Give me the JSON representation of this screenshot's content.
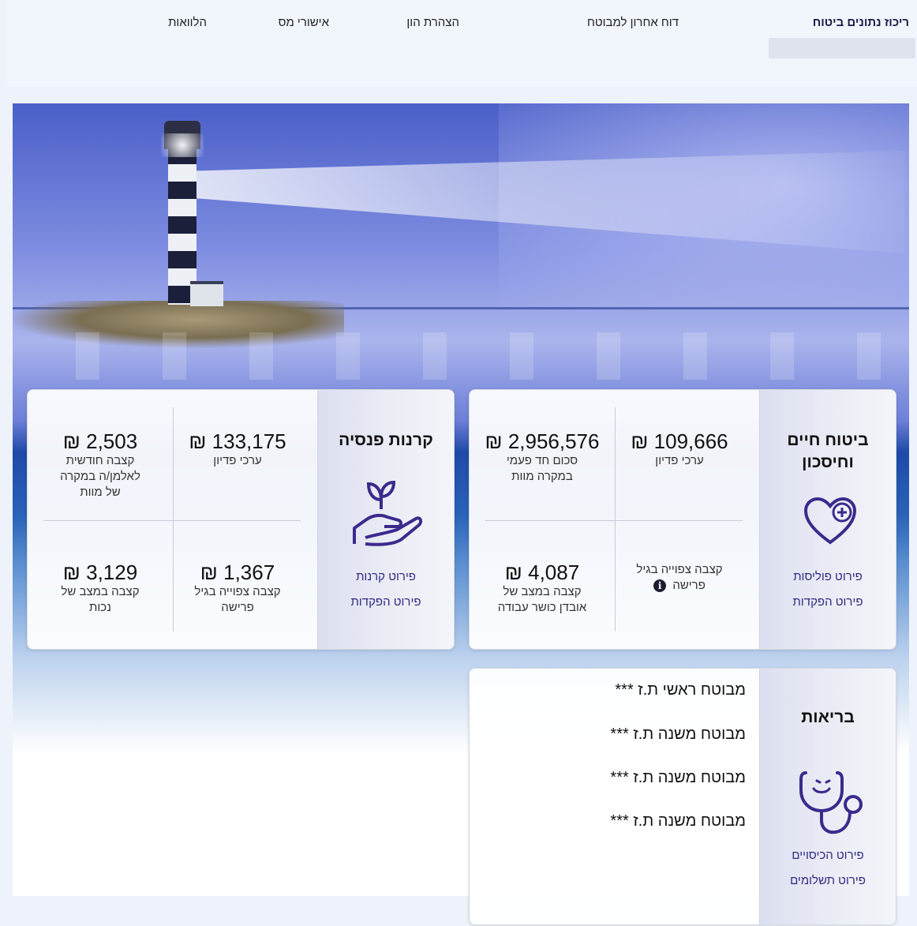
{
  "nav": {
    "tabs": [
      {
        "label": "ריכוז נתונים ביטוח"
      },
      {
        "label": "דוח אחרון למבוטח"
      },
      {
        "label": "הצהרת הון"
      },
      {
        "label": "אישורי מס"
      },
      {
        "label": "הלוואות"
      }
    ]
  },
  "life": {
    "title_line1": "ביטוח חיים",
    "title_line2": "וחיסכון",
    "icon": "heart-plus-icon",
    "links": [
      "פירוט פוליסות",
      "פירוט הפקדות"
    ],
    "cells": [
      {
        "amount": "109,666 ₪",
        "label_lines": [
          "ערכי פדיון"
        ]
      },
      {
        "amount": "2,956,576 ₪",
        "label_lines": [
          "סכום חד פעמי",
          "במקרה מוות"
        ]
      },
      {
        "amount": "",
        "label_lines": [
          "קצבה צפוייה בגיל",
          "פרישה"
        ]
      },
      {
        "amount": "4,087 ₪",
        "label_lines": [
          "קצבה במצב של",
          "אובדן כושר עבודה"
        ]
      }
    ]
  },
  "pension": {
    "title": "קרנות פנסיה",
    "icon": "hand-plant-icon",
    "links": [
      "פירוט קרנות",
      "פירוט הפקדות"
    ],
    "cells": [
      {
        "amount": "133,175 ₪",
        "label_lines": [
          "ערכי פדיון"
        ]
      },
      {
        "amount": "2,503 ₪",
        "label_lines": [
          "קצבה חודשית",
          "לאלמן/ה במקרה",
          "של מוות"
        ]
      },
      {
        "amount": "1,367 ₪",
        "label_lines": [
          "קצבה צפוייה בגיל",
          "פרישה"
        ]
      },
      {
        "amount": "3,129 ₪",
        "label_lines": [
          "קצבה במצב של",
          "נכות"
        ]
      }
    ]
  },
  "health": {
    "title": "בריאות",
    "icon": "stethoscope-icon",
    "links": [
      "פירוט הכיסויים",
      "פירוט תשלומים"
    ],
    "insured": [
      "מבוטח ראשי ת.ז ***",
      "מבוטח משנה ת.ז ***",
      "מבוטח משנה ת.ז ***",
      "מבוטח משנה ת.ז ***"
    ]
  },
  "colors": {
    "accent": "#2e2a80",
    "icon": "#3b2a8c"
  }
}
